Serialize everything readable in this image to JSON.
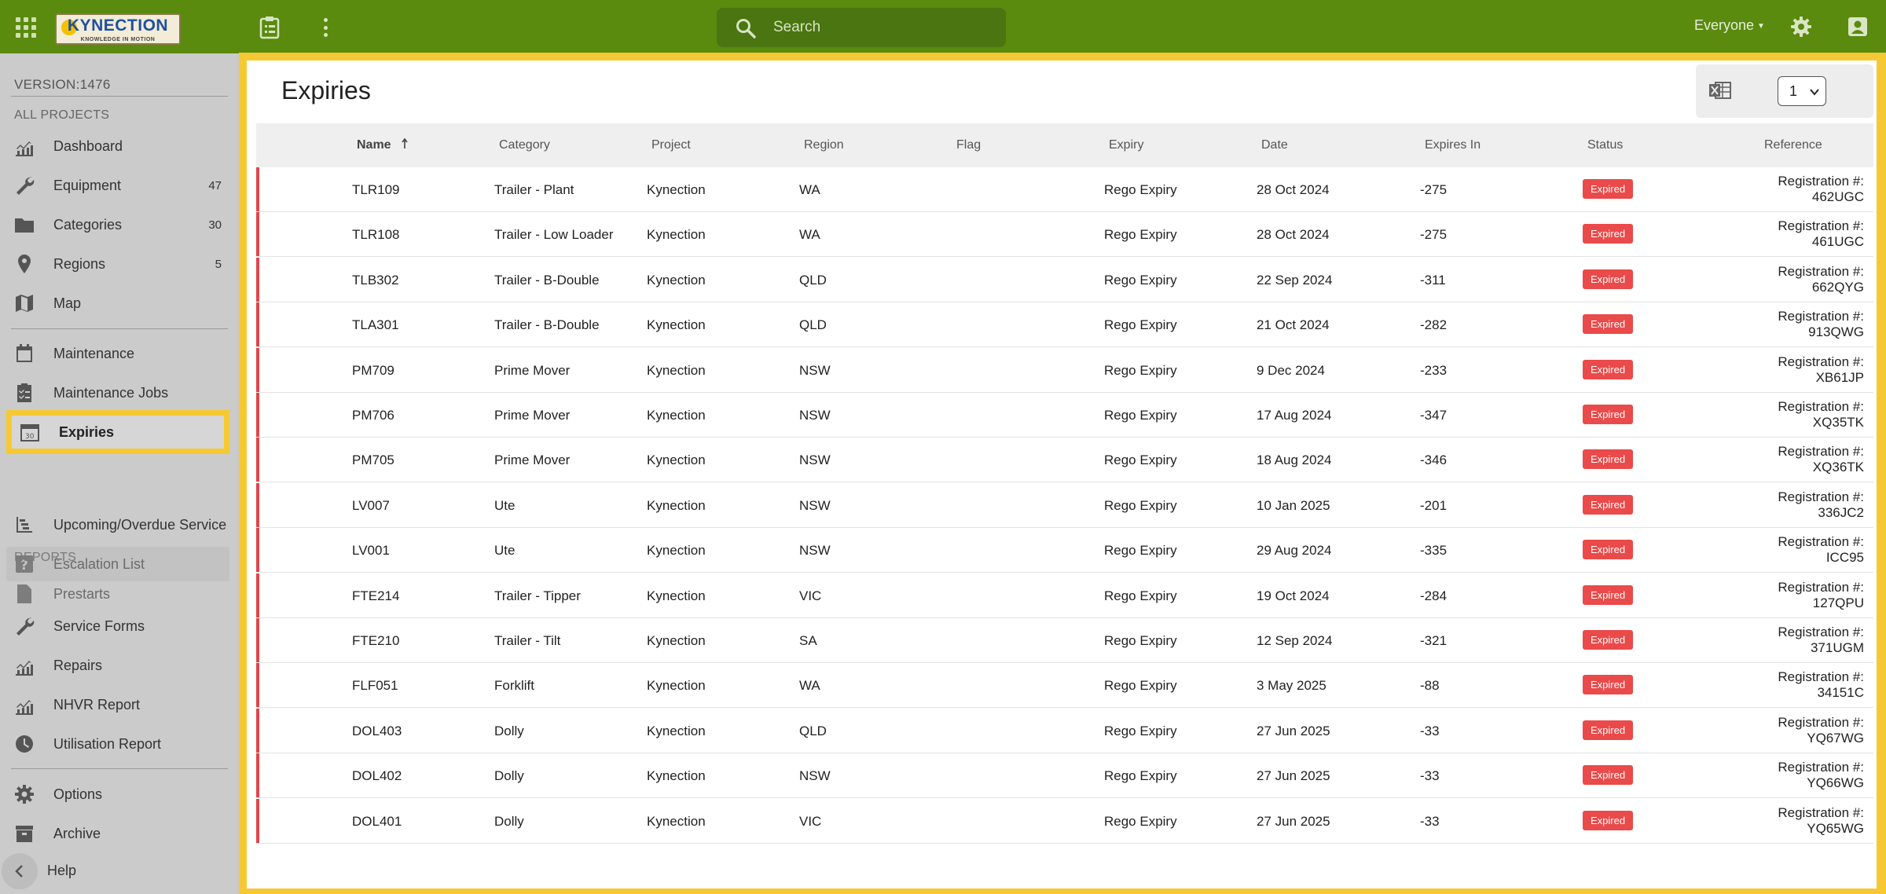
{
  "header": {
    "logo_text": "KYNECTION",
    "logo_tagline": "KNOWLEDGE IN MOTION",
    "search_placeholder": "Search",
    "user_scope": "Everyone"
  },
  "sidebar": {
    "version": "VERSION:1476",
    "all_projects_label": "ALL PROJECTS",
    "reports_label": "REPORTS",
    "items": [
      {
        "label": "Dashboard",
        "icon": "chart-icon",
        "count": ""
      },
      {
        "label": "Equipment",
        "icon": "wrench-icon",
        "count": "47"
      },
      {
        "label": "Categories",
        "icon": "folder-icon",
        "count": "30"
      },
      {
        "label": "Regions",
        "icon": "pin-icon",
        "count": "5"
      },
      {
        "label": "Map",
        "icon": "map-icon",
        "count": ""
      },
      {
        "label": "Maintenance",
        "icon": "calendar-icon",
        "count": ""
      },
      {
        "label": "Maintenance Jobs",
        "icon": "checklist-icon",
        "count": ""
      },
      {
        "label": "Expiries",
        "icon": "calendar-30-icon",
        "count": ""
      },
      {
        "label": "Upcoming/Overdue Service",
        "icon": "timeline-icon",
        "count": ""
      },
      {
        "label": "Escalation List",
        "icon": "question-icon",
        "count": ""
      },
      {
        "label": "Prestarts",
        "icon": "document-icon",
        "count": ""
      },
      {
        "label": "Service Forms",
        "icon": "wrench-icon",
        "count": ""
      },
      {
        "label": "Repairs",
        "icon": "chart-icon",
        "count": ""
      },
      {
        "label": "NHVR Report",
        "icon": "chart-icon",
        "count": ""
      },
      {
        "label": "Utilisation Report",
        "icon": "clock-icon",
        "count": ""
      },
      {
        "label": "Options",
        "icon": "gear-icon",
        "count": ""
      },
      {
        "label": "Archive",
        "icon": "archive-icon",
        "count": ""
      }
    ],
    "help_label": "Help"
  },
  "main": {
    "title": "Expiries",
    "page_selector": "1",
    "columns": [
      "Name",
      "Category",
      "Project",
      "Region",
      "Flag",
      "Expiry",
      "Date",
      "Expires In",
      "Status",
      "Reference"
    ],
    "rows": [
      {
        "name": "TLR109",
        "category": "Trailer - Plant",
        "project": "Kynection",
        "region": "WA",
        "flag": "",
        "expiry": "Rego Expiry",
        "date": "28 Oct 2024",
        "expires_in": "-275",
        "status": "Expired",
        "ref_label": "Registration #:",
        "ref_value": "462UGC"
      },
      {
        "name": "TLR108",
        "category": "Trailer - Low Loader",
        "project": "Kynection",
        "region": "WA",
        "flag": "",
        "expiry": "Rego Expiry",
        "date": "28 Oct 2024",
        "expires_in": "-275",
        "status": "Expired",
        "ref_label": "Registration #:",
        "ref_value": "461UGC"
      },
      {
        "name": "TLB302",
        "category": "Trailer - B-Double",
        "project": "Kynection",
        "region": "QLD",
        "flag": "",
        "expiry": "Rego Expiry",
        "date": "22 Sep 2024",
        "expires_in": "-311",
        "status": "Expired",
        "ref_label": "Registration #:",
        "ref_value": "662QYG"
      },
      {
        "name": "TLA301",
        "category": "Trailer - B-Double",
        "project": "Kynection",
        "region": "QLD",
        "flag": "",
        "expiry": "Rego Expiry",
        "date": "21 Oct 2024",
        "expires_in": "-282",
        "status": "Expired",
        "ref_label": "Registration #:",
        "ref_value": "913QWG"
      },
      {
        "name": "PM709",
        "category": "Prime Mover",
        "project": "Kynection",
        "region": "NSW",
        "flag": "",
        "expiry": "Rego Expiry",
        "date": "9 Dec 2024",
        "expires_in": "-233",
        "status": "Expired",
        "ref_label": "Registration #:",
        "ref_value": "XB61JP"
      },
      {
        "name": "PM706",
        "category": "Prime Mover",
        "project": "Kynection",
        "region": "NSW",
        "flag": "",
        "expiry": "Rego Expiry",
        "date": "17 Aug 2024",
        "expires_in": "-347",
        "status": "Expired",
        "ref_label": "Registration #:",
        "ref_value": "XQ35TK"
      },
      {
        "name": "PM705",
        "category": "Prime Mover",
        "project": "Kynection",
        "region": "NSW",
        "flag": "",
        "expiry": "Rego Expiry",
        "date": "18 Aug 2024",
        "expires_in": "-346",
        "status": "Expired",
        "ref_label": "Registration #:",
        "ref_value": "XQ36TK"
      },
      {
        "name": "LV007",
        "category": "Ute",
        "project": "Kynection",
        "region": "NSW",
        "flag": "",
        "expiry": "Rego Expiry",
        "date": "10 Jan 2025",
        "expires_in": "-201",
        "status": "Expired",
        "ref_label": "Registration #:",
        "ref_value": "336JC2"
      },
      {
        "name": "LV001",
        "category": "Ute",
        "project": "Kynection",
        "region": "NSW",
        "flag": "",
        "expiry": "Rego Expiry",
        "date": "29 Aug 2024",
        "expires_in": "-335",
        "status": "Expired",
        "ref_label": "Registration #:",
        "ref_value": "ICC95"
      },
      {
        "name": "FTE214",
        "category": "Trailer - Tipper",
        "project": "Kynection",
        "region": "VIC",
        "flag": "",
        "expiry": "Rego Expiry",
        "date": "19 Oct 2024",
        "expires_in": "-284",
        "status": "Expired",
        "ref_label": "Registration #:",
        "ref_value": "127QPU"
      },
      {
        "name": "FTE210",
        "category": "Trailer - Tilt",
        "project": "Kynection",
        "region": "SA",
        "flag": "",
        "expiry": "Rego Expiry",
        "date": "12 Sep 2024",
        "expires_in": "-321",
        "status": "Expired",
        "ref_label": "Registration #:",
        "ref_value": "371UGM"
      },
      {
        "name": "FLF051",
        "category": "Forklift",
        "project": "Kynection",
        "region": "WA",
        "flag": "",
        "expiry": "Rego Expiry",
        "date": "3 May 2025",
        "expires_in": "-88",
        "status": "Expired",
        "ref_label": "Registration #:",
        "ref_value": "34151C"
      },
      {
        "name": "DOL403",
        "category": "Dolly",
        "project": "Kynection",
        "region": "QLD",
        "flag": "",
        "expiry": "Rego Expiry",
        "date": "27 Jun 2025",
        "expires_in": "-33",
        "status": "Expired",
        "ref_label": "Registration #:",
        "ref_value": "YQ67WG"
      },
      {
        "name": "DOL402",
        "category": "Dolly",
        "project": "Kynection",
        "region": "NSW",
        "flag": "",
        "expiry": "Rego Expiry",
        "date": "27 Jun 2025",
        "expires_in": "-33",
        "status": "Expired",
        "ref_label": "Registration #:",
        "ref_value": "YQ66WG"
      },
      {
        "name": "DOL401",
        "category": "Dolly",
        "project": "Kynection",
        "region": "VIC",
        "flag": "",
        "expiry": "Rego Expiry",
        "date": "27 Jun 2025",
        "expires_in": "-33",
        "status": "Expired",
        "ref_label": "Registration #:",
        "ref_value": "YQ65WG"
      }
    ]
  },
  "colors": {
    "topbar": "#5a8a0e",
    "highlight": "#f6c934",
    "expired_badge": "#ea4a4a",
    "row_flag": "#e0474c"
  }
}
